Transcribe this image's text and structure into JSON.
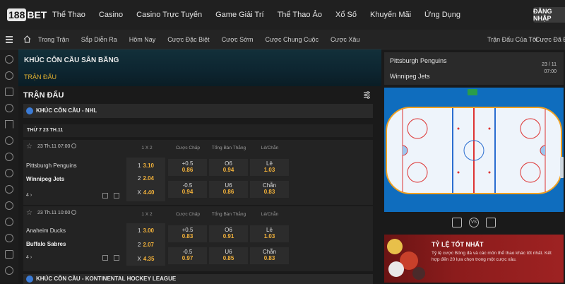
{
  "brand": {
    "logo_num": "188",
    "logo_text": "BET"
  },
  "topnav": [
    "Thể Thao",
    "Casino",
    "Casino Trực Tuyến",
    "Game Giải Trí",
    "Thể Thao Ảo",
    "Xổ Số",
    "Khuyến Mãi",
    "Ứng Dụng"
  ],
  "login_label": "ĐĂNG NHẬP",
  "subnav": [
    "Trong Trận",
    "Sắp Diễn Ra",
    "Hôm Nay",
    "Cược Đặc Biệt",
    "Cược Sớm",
    "Cược Chung Cuộc",
    "Cược Xâu"
  ],
  "subnav_right": [
    "Trận Đấu Của Tôi",
    "Cược Đã Đặt"
  ],
  "banner": {
    "title": "KHÚC CÔN CẦU SÂN BĂNG",
    "tab": "TRẬN ĐẤU"
  },
  "main_heading": "TRẬN ĐẤU",
  "league1": "KHÚC CÔN CẦU - NHL",
  "league2": "KHÚC CÔN CẦU - KONTINENTAL HOCKEY LEAGUE",
  "date_label": "THỨ 7 23 TH.11",
  "columns": [
    "1 X 2",
    "Cược Chấp",
    "Tổng Bàn Thắng",
    "Lẻ/Chẵn"
  ],
  "matches": [
    {
      "time": "23 Th.11 07:00",
      "home": "Pittsburgh Penguins",
      "away": "Winnipeg Jets",
      "more": "4",
      "x12": [
        {
          "l": "1",
          "o": "3.10"
        },
        {
          "l": "2",
          "o": "2.04"
        },
        {
          "l": "X",
          "o": "4.40"
        }
      ],
      "handicap": [
        {
          "l": "+0.5",
          "o": "0.86"
        },
        {
          "l": "-0.5",
          "o": "0.94"
        }
      ],
      "total": [
        {
          "l": "O6",
          "o": "0.94"
        },
        {
          "l": "U6",
          "o": "0.86"
        }
      ],
      "oddeven": [
        {
          "l": "Lẻ",
          "o": "1.03"
        },
        {
          "l": "Chẵn",
          "o": "0.83"
        }
      ]
    },
    {
      "time": "23 Th.11 10:00",
      "home": "Anaheim Ducks",
      "away": "Buffalo Sabres",
      "more": "4",
      "x12": [
        {
          "l": "1",
          "o": "3.00"
        },
        {
          "l": "2",
          "o": "2.07"
        },
        {
          "l": "X",
          "o": "4.35"
        }
      ],
      "handicap": [
        {
          "l": "+0.5",
          "o": "0.83"
        },
        {
          "l": "-0.5",
          "o": "0.97"
        }
      ],
      "total": [
        {
          "l": "O6",
          "o": "0.91"
        },
        {
          "l": "U6",
          "o": "0.85"
        }
      ],
      "oddeven": [
        {
          "l": "Lẻ",
          "o": "1.03"
        },
        {
          "l": "Chẵn",
          "o": "0.83"
        }
      ]
    }
  ],
  "right_panel": {
    "team1": "Pittsburgh Penguins",
    "team2": "Winnipeg Jets",
    "date": "23 / 11",
    "time": "07:00"
  },
  "tools": {
    "vs": "VS"
  },
  "promo": {
    "title": "TỶ LỆ TỐT NHẤT",
    "desc": "Tỷ lệ cược Bóng đá và các môn thể thao khác tốt nhất. Kết hợp đến 20 lựa chọn trong một cược xâu."
  },
  "colors": {
    "odds": "#f3b23a",
    "rink_bg": "#0f6dbe",
    "promo_bg": "#8c1c1c"
  }
}
